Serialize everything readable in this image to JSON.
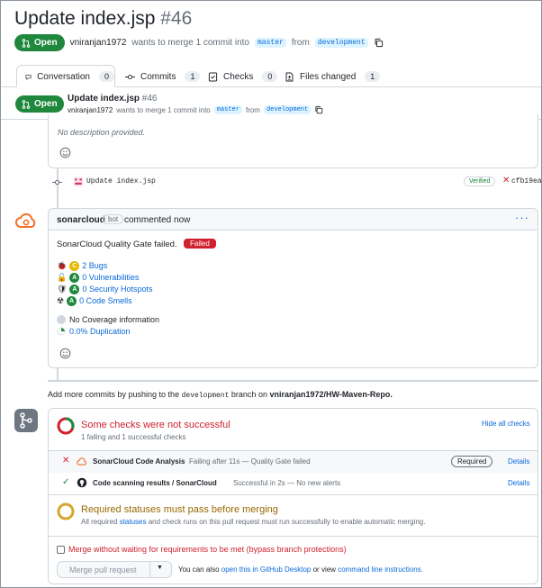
{
  "header": {
    "title": "Update index.jsp",
    "number": "#46",
    "status": "Open",
    "author": "vniranjan1972",
    "merge_text": "wants to merge 1 commit into",
    "base_branch": "master",
    "from_text": "from",
    "head_branch": "development"
  },
  "tabs": [
    {
      "label": "Conversation",
      "count": "0"
    },
    {
      "label": "Commits",
      "count": "1"
    },
    {
      "label": "Checks",
      "count": "0"
    },
    {
      "label": "Files changed",
      "count": "1"
    }
  ],
  "sticky": {
    "status": "Open",
    "title": "Update index.jsp",
    "number": "#46",
    "author": "vniranjan1972",
    "merge_text": "wants to merge 1 commit into",
    "base_branch": "master",
    "from_text": "from",
    "head_branch": "development"
  },
  "description": {
    "text": "No description provided."
  },
  "commit": {
    "message": "Update index.jsp",
    "verified": "Verified",
    "sha": "cfb19ea"
  },
  "comment": {
    "author": "sonarcloud",
    "badge": "bot",
    "action": "commented now",
    "quality_gate_text": "SonarCloud Quality Gate failed.",
    "failed_label": "Failed",
    "metrics": [
      {
        "grade": "C",
        "label": "2 Bugs"
      },
      {
        "grade": "A",
        "label": "0 Vulnerabilities"
      },
      {
        "grade": "A",
        "label": "0 Security Hotspots"
      },
      {
        "grade": "A",
        "label": "0 Code Smells"
      }
    ],
    "coverage": "No Coverage information",
    "duplication": "0.0% Duplication"
  },
  "push_hint": {
    "prefix": "Add more commits by pushing to the",
    "branch": "development",
    "middle": "branch on",
    "repo": "vniranjan1972/HW-Maven-Repo."
  },
  "checks": {
    "title": "Some checks were not successful",
    "subtitle": "1 failing and 1 successful checks",
    "hide_all": "Hide all checks",
    "rows": [
      {
        "name": "SonarCloud Code Analysis",
        "desc": "Failing after 11s — Quality Gate failed",
        "required": "Required",
        "details": "Details"
      },
      {
        "name": "Code scanning results / SonarCloud",
        "desc": "Successful in 2s — No new alerts",
        "details": "Details"
      }
    ]
  },
  "required": {
    "title": "Required statuses must pass before merging",
    "text_prefix": "All required",
    "statuses_link": "statuses",
    "text_suffix": "and check runs on this pull request must run successfully to enable automatic merging."
  },
  "bypass": {
    "label": "Merge without waiting for requirements to be met (bypass branch protections)"
  },
  "merge": {
    "button": "Merge pull request",
    "hint_prefix": "You can also",
    "desktop_link": "open this in GitHub Desktop",
    "or_text": "or view",
    "cli_link": "command line instructions."
  },
  "colors": {
    "open_green": "#1f883d",
    "failed_red": "#cf222e",
    "link_blue": "#0969da",
    "pending_yellow": "#9a6700"
  }
}
